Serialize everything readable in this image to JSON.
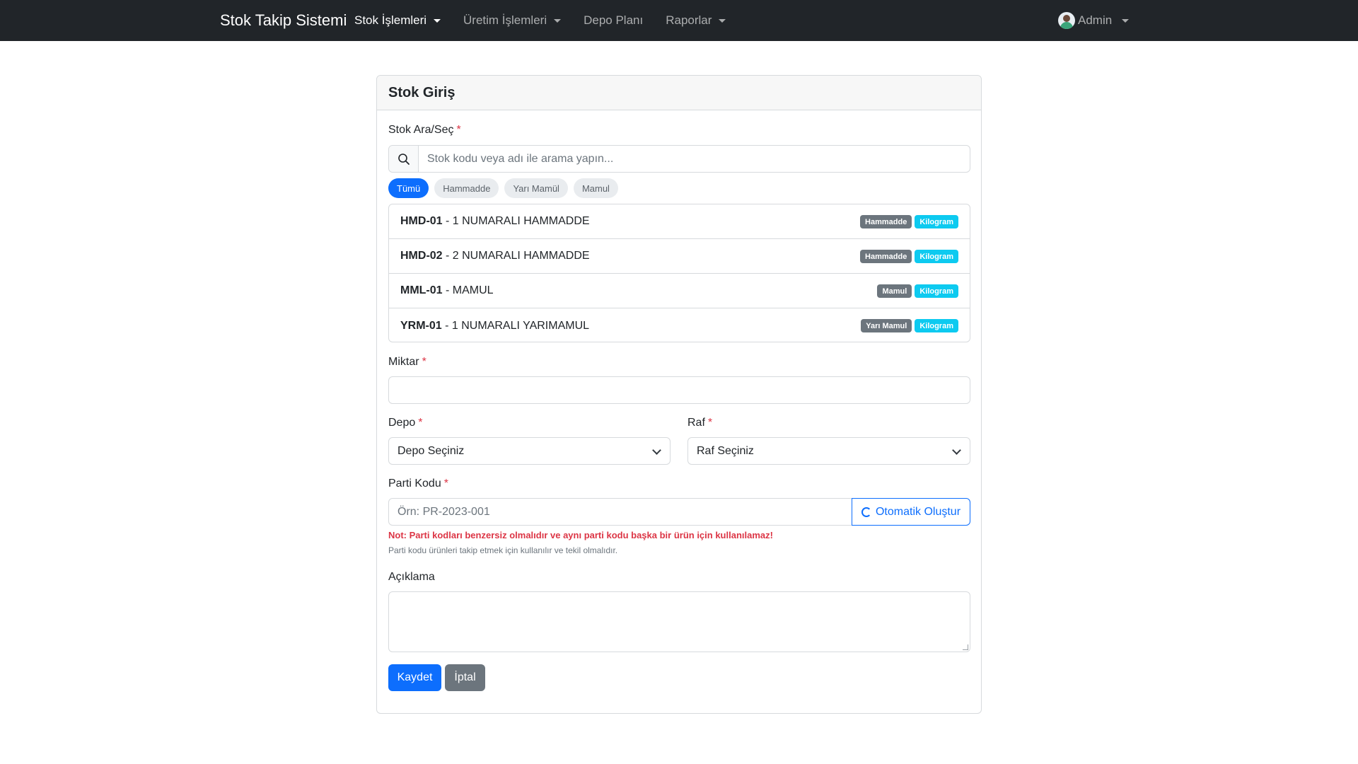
{
  "navbar": {
    "brand": "Stok Takip Sistemi",
    "items": [
      {
        "label": "Stok İşlemleri",
        "dropdown": true,
        "active": true
      },
      {
        "label": "Üretim İşlemleri",
        "dropdown": true,
        "active": false
      },
      {
        "label": "Depo Planı",
        "dropdown": false,
        "active": false
      },
      {
        "label": "Raporlar",
        "dropdown": true,
        "active": false
      }
    ],
    "user": "Admin"
  },
  "form": {
    "title": "Stok Giriş",
    "stock_label": "Stok Ara/Seç",
    "required_mark": "*",
    "search_placeholder": "Stok kodu veya adı ile arama yapın...",
    "filters": [
      "Tümü",
      "Hammadde",
      "Yarı Mamül",
      "Mamul"
    ],
    "active_filter": "Tümü",
    "stocks": [
      {
        "code": "HMD-01",
        "name": " - 1 NUMARALI HAMMADDE",
        "type": "Hammadde",
        "unit": "Kilogram"
      },
      {
        "code": "HMD-02",
        "name": " - 2 NUMARALI HAMMADDE",
        "type": "Hammadde",
        "unit": "Kilogram"
      },
      {
        "code": "MML-01",
        "name": " - MAMUL",
        "type": "Mamul",
        "unit": "Kilogram"
      },
      {
        "code": "YRM-01",
        "name": " - 1 NUMARALI YARIMAMUL",
        "type": "Yarı Mamul",
        "unit": "Kilogram"
      }
    ],
    "quantity_label": "Miktar",
    "quantity_value": "",
    "warehouse_label": "Depo",
    "warehouse_value": "Depo Seçiniz",
    "shelf_label": "Raf",
    "shelf_value": "Raf Seçiniz",
    "batch_label": "Parti Kodu",
    "batch_placeholder": "Örn: PR-2023-001",
    "auto_generate": "Otomatik Oluştur",
    "note": "Not: Parti kodları benzersiz olmalıdır ve aynı parti kodu başka bir ürün için kullanılamaz!",
    "help": "Parti kodu ürünleri takip etmek için kullanılır ve tekil olmalıdır.",
    "description_label": "Açıklama",
    "save": "Kaydet",
    "cancel": "İptal"
  },
  "colors": {
    "primary": "#0d6efd",
    "navbar": "#212529",
    "danger": "#dc3545",
    "info": "#0dcaf0",
    "secondary": "#6c757d"
  }
}
